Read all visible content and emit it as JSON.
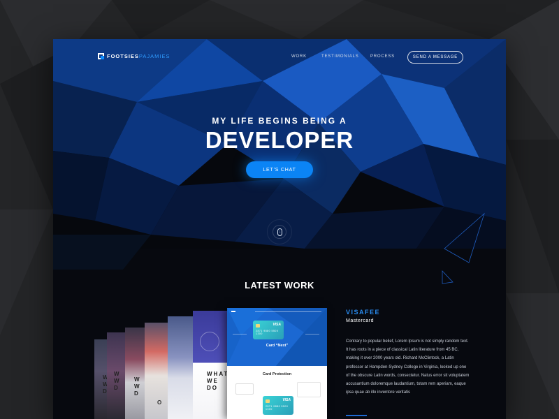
{
  "nav": {
    "logo_primary": "FOOTSIES",
    "logo_accent": "PAJAMIES",
    "links": [
      "WORK",
      "TESTIMONIALS",
      "PROCESS"
    ],
    "cta": "SEND A MESSAGE"
  },
  "hero": {
    "subtitle": "MY LIFE BEGINS BEING A",
    "title": "DEVELOPER",
    "button": "LET'S CHAT"
  },
  "latest_work": {
    "title": "LATEST WORK",
    "card_headline_letters": [
      "WHAT",
      "WE",
      "DO"
    ],
    "main_card": {
      "card_title": "Card “Next”",
      "section_title": "Card Protection",
      "visa_label": "VISA",
      "card_number": "2871 9880 5500 1300"
    },
    "project": {
      "name": "VISAFEE",
      "subtitle": "Mastercard",
      "description": "Contrary to popular belief, Lorem Ipsum is not simply random text. It has roots in a piece of classical Latin literature from 45 BC, making it over 2000 years old. Richard McClintock, a Latin professor at Hampden-Sydney College in Virginia, looked up one of the obscure Latin words, consectetur. Natus error sit voluptatem accusantium doloremque laudantium, totam rem aperiam, eaque ipsa quae ab illo inventore veritatis"
    }
  },
  "colors": {
    "accent": "#0b84f5",
    "background": "#232426",
    "hero_dark": "#07090f"
  },
  "icons": [
    "logo-mark-icon",
    "scroll-mouse-icon",
    "arrow-down-icon"
  ]
}
